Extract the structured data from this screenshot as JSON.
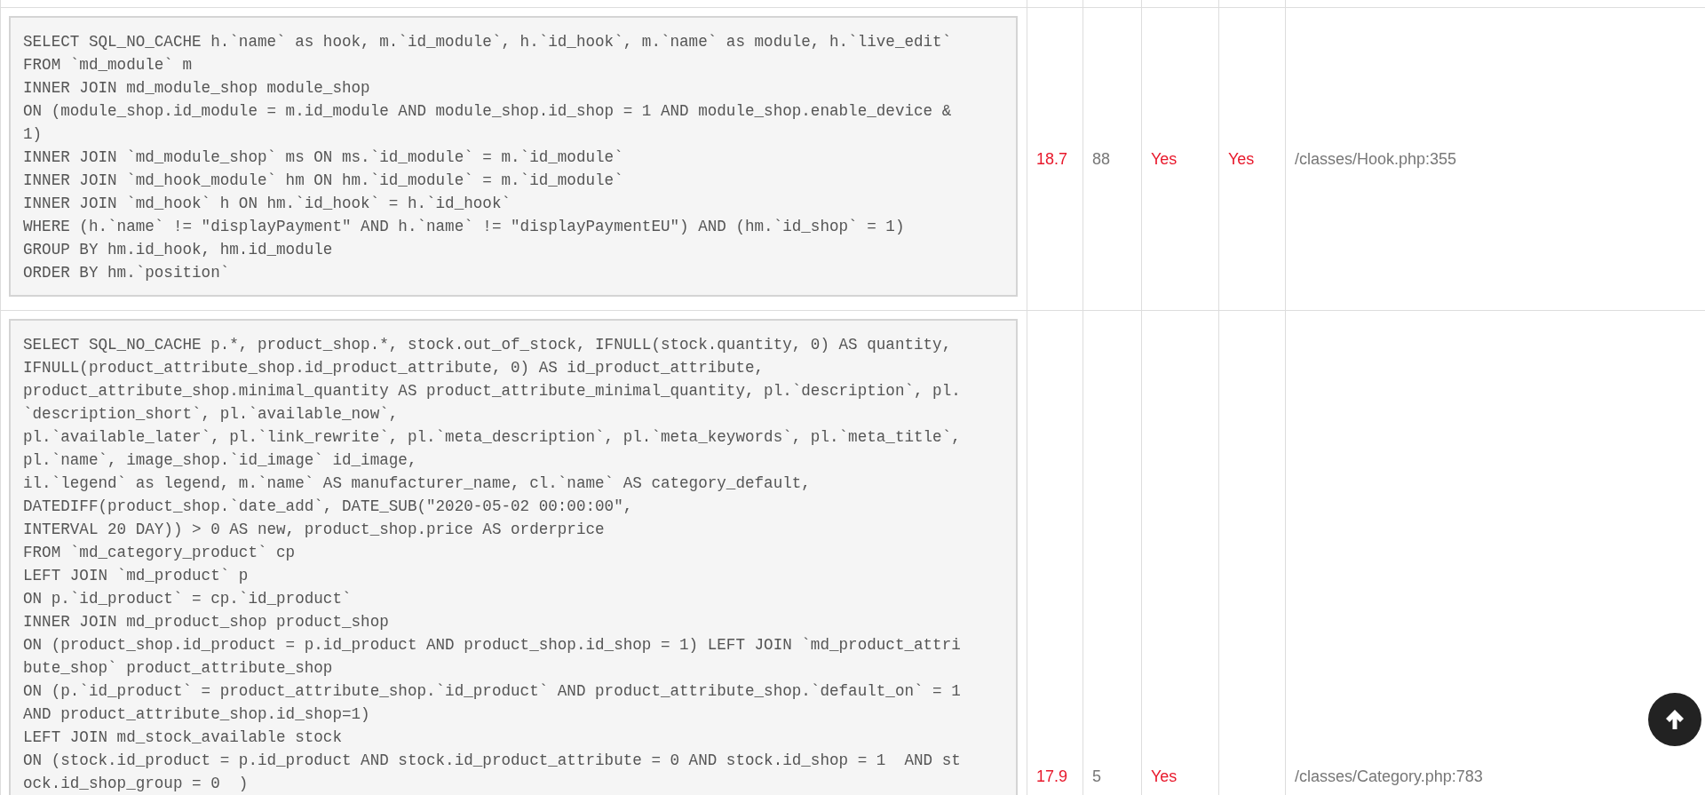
{
  "rows": [
    {
      "query": [
        "SELECT SQL_NO_CACHE h.`name` as hook, m.`id_module`, h.`id_hook`, m.`name` as module, h.`live_edit`",
        "FROM `md_module` m",
        "INNER JOIN md_module_shop module_shop",
        "ON (module_shop.id_module = m.id_module AND module_shop.id_shop = 1 AND module_shop.enable_device &",
        "1)",
        "INNER JOIN `md_module_shop` ms ON ms.`id_module` = m.`id_module`",
        "INNER JOIN `md_hook_module` hm ON hm.`id_module` = m.`id_module`",
        "INNER JOIN `md_hook` h ON hm.`id_hook` = h.`id_hook`",
        "WHERE (h.`name` != \"displayPayment\" AND h.`name` != \"displayPaymentEU\") AND (hm.`id_shop` = 1)",
        "GROUP BY hm.id_hook, hm.id_module",
        "ORDER BY hm.`position`"
      ],
      "column_2": "18.7",
      "column_3": "88",
      "column_4": "Yes",
      "column_5": "Yes",
      "column_6": "/classes/Hook.php:355"
    },
    {
      "query": [
        "SELECT SQL_NO_CACHE p.*, product_shop.*, stock.out_of_stock, IFNULL(stock.quantity, 0) AS quantity,",
        "IFNULL(product_attribute_shop.id_product_attribute, 0) AS id_product_attribute,",
        "product_attribute_shop.minimal_quantity AS product_attribute_minimal_quantity, pl.`description`, pl.",
        "`description_short`, pl.`available_now`,",
        "pl.`available_later`, pl.`link_rewrite`, pl.`meta_description`, pl.`meta_keywords`, pl.`meta_title`,",
        "pl.`name`, image_shop.`id_image` id_image,",
        "il.`legend` as legend, m.`name` AS manufacturer_name, cl.`name` AS category_default,",
        "DATEDIFF(product_shop.`date_add`, DATE_SUB(\"2020-05-02 00:00:00\",",
        "INTERVAL 20 DAY)) > 0 AS new, product_shop.price AS orderprice",
        "FROM `md_category_product` cp",
        "LEFT JOIN `md_product` p",
        "ON p.`id_product` = cp.`id_product`",
        "INNER JOIN md_product_shop product_shop",
        "ON (product_shop.id_product = p.id_product AND product_shop.id_shop = 1) LEFT JOIN `md_product_attri",
        "bute_shop` product_attribute_shop",
        "ON (p.`id_product` = product_attribute_shop.`id_product` AND product_attribute_shop.`default_on` = 1",
        "AND product_attribute_shop.id_shop=1)",
        "LEFT JOIN md_stock_available stock",
        "ON (stock.id_product = p.id_product AND stock.id_product_attribute = 0 AND stock.id_shop = 1  AND st",
        "ock.id_shop_group = 0  )"
      ],
      "column_2": "17.9",
      "column_3": "5",
      "column_4": "Yes",
      "column_6": "/classes/Category.php:783"
    }
  ]
}
